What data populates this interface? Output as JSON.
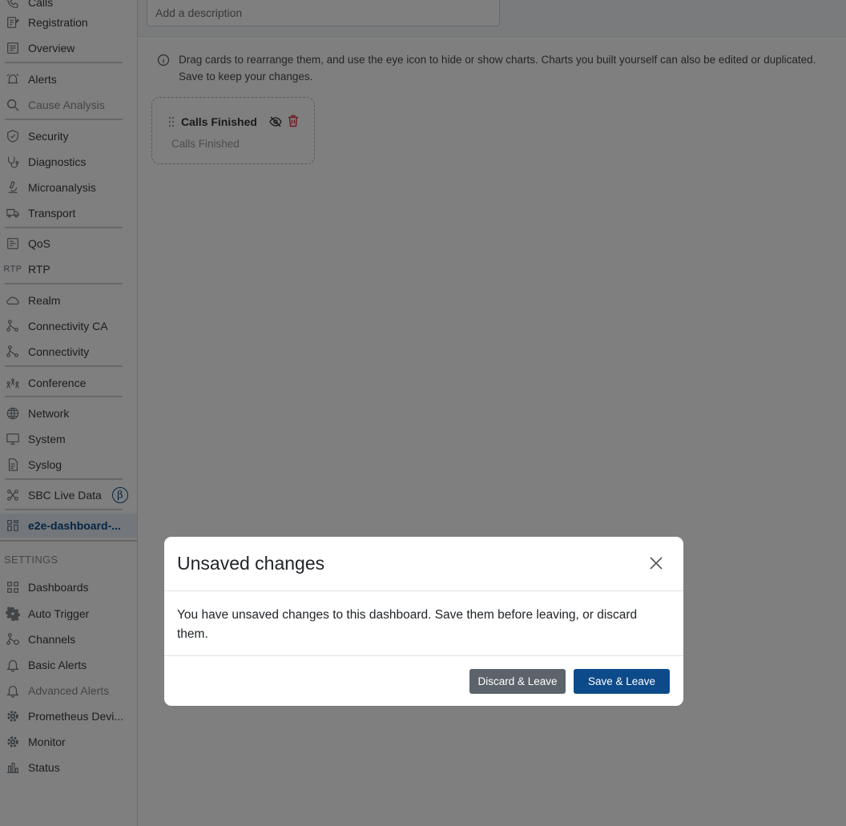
{
  "sidebar": {
    "items": [
      {
        "label": "Calls",
        "icon": "phone-icon"
      },
      {
        "label": "Registration",
        "icon": "registration-icon"
      },
      {
        "label": "Overview",
        "icon": "overview-icon"
      },
      {
        "label": "Alerts",
        "icon": "alarm-icon"
      },
      {
        "label": "Cause Analysis",
        "icon": "search-icon"
      },
      {
        "label": "Security",
        "icon": "shield-icon"
      },
      {
        "label": "Diagnostics",
        "icon": "stethoscope-icon"
      },
      {
        "label": "Microanalysis",
        "icon": "microscope-icon"
      },
      {
        "label": "Transport",
        "icon": "truck-icon"
      },
      {
        "label": "QoS",
        "icon": "qos-icon"
      },
      {
        "label": "RTP",
        "icon": "rtp-icon"
      },
      {
        "label": "Realm",
        "icon": "cloud-icon"
      },
      {
        "label": "Connectivity CA",
        "icon": "connectivity-icon"
      },
      {
        "label": "Connectivity",
        "icon": "connectivity-icon"
      },
      {
        "label": "Conference",
        "icon": "people-icon"
      },
      {
        "label": "Network",
        "icon": "globe-icon"
      },
      {
        "label": "System",
        "icon": "monitor-icon"
      },
      {
        "label": "Syslog",
        "icon": "document-icon"
      },
      {
        "label": "SBC Live Data",
        "icon": "graph-icon",
        "badge": "β"
      },
      {
        "label": "e2e-dashboard-...",
        "icon": "dashboard-icon"
      }
    ],
    "settings_header": "SETTINGS",
    "settings_items": [
      {
        "label": "Dashboards",
        "icon": "dashboard-icon"
      },
      {
        "label": "Auto Trigger",
        "icon": "gear-icon"
      },
      {
        "label": "Channels",
        "icon": "channels-icon"
      },
      {
        "label": "Basic Alerts",
        "icon": "bell-icon"
      },
      {
        "label": "Advanced Alerts",
        "icon": "bell-icon"
      },
      {
        "label": "Prometheus Devi...",
        "icon": "gear-icon"
      },
      {
        "label": "Monitor",
        "icon": "gear-icon"
      },
      {
        "label": "Status",
        "icon": "bar-chart-icon"
      }
    ],
    "rtp_icon_text": "RTP"
  },
  "main": {
    "description_placeholder": "Add a description",
    "info_text": "Drag cards to rearrange them, and use the eye icon to hide or show charts. Charts you built yourself can also be edited or duplicated. Save to keep your changes.",
    "card": {
      "title": "Calls Finished",
      "subtitle": "Calls Finished"
    }
  },
  "modal": {
    "title": "Unsaved changes",
    "body": "You have unsaved changes to this dashboard. Save them before leaving, or discard them.",
    "discard_label": "Discard & Leave",
    "save_label": "Save & Leave"
  },
  "colors": {
    "primary": "#0d4a8a",
    "secondary": "#5c636a",
    "danger": "#dc3545"
  }
}
